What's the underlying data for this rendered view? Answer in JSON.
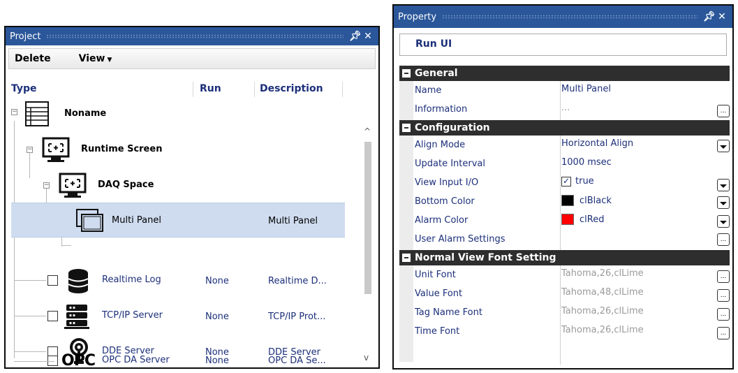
{
  "project": {
    "title": "Project",
    "pin": "p",
    "close": "✕",
    "toolbar": {
      "delete": "Delete",
      "view": "View"
    },
    "columns": {
      "type": "Type",
      "run": "Run",
      "description": "Description"
    },
    "rows": [
      {
        "label": "Noname",
        "run": "",
        "desc": ""
      },
      {
        "label": "Runtime Screen",
        "run": "",
        "desc": ""
      },
      {
        "label": "DAQ Space",
        "run": "",
        "desc": ""
      },
      {
        "label": "Multi Panel",
        "run": "",
        "desc": "Multi Panel"
      },
      {
        "label": "Realtime Log",
        "run": "None",
        "desc": "Realtime D..."
      },
      {
        "label": "TCP/IP Server",
        "run": "None",
        "desc": "TCP/IP Prot..."
      },
      {
        "label": "DDE Server",
        "run": "None",
        "desc": "DDE Server"
      },
      {
        "label": "OPC DA Server",
        "run": "None",
        "desc": "OPC DA Se...",
        "icon_text": "OPC"
      }
    ]
  },
  "property": {
    "title": "Property",
    "close": "✕",
    "object": "Run UI",
    "categories": [
      {
        "name": "General",
        "items": [
          {
            "name": "Name",
            "value": "Multi Panel"
          },
          {
            "name": "Information",
            "value": "...",
            "ellipsis": "..."
          }
        ]
      },
      {
        "name": "Configuration",
        "items": [
          {
            "name": "Align Mode",
            "value": "Horizontal Align"
          },
          {
            "name": "Update Interval",
            "value": "1000 msec"
          },
          {
            "name": "View Input I/O",
            "value": "true",
            "check": "✓"
          },
          {
            "name": "Bottom Color",
            "value": "clBlack",
            "color": "#000000"
          },
          {
            "name": "Alarm Color",
            "value": "clRed",
            "color": "#ff0000"
          },
          {
            "name": "User Alarm Settings",
            "value": "",
            "ellipsis": "..."
          }
        ]
      },
      {
        "name": "Normal View Font Setting",
        "items": [
          {
            "name": "Unit Font",
            "value": "Tahoma,26,clLime",
            "ellipsis": "..."
          },
          {
            "name": "Value Font",
            "value": "Tahoma,48,clLime",
            "ellipsis": "..."
          },
          {
            "name": "Tag Name Font",
            "value": "Tahoma,26,clLime",
            "ellipsis": "..."
          },
          {
            "name": "Time Font",
            "value": "Tahoma,26,clLime",
            "ellipsis": "..."
          }
        ]
      }
    ]
  }
}
